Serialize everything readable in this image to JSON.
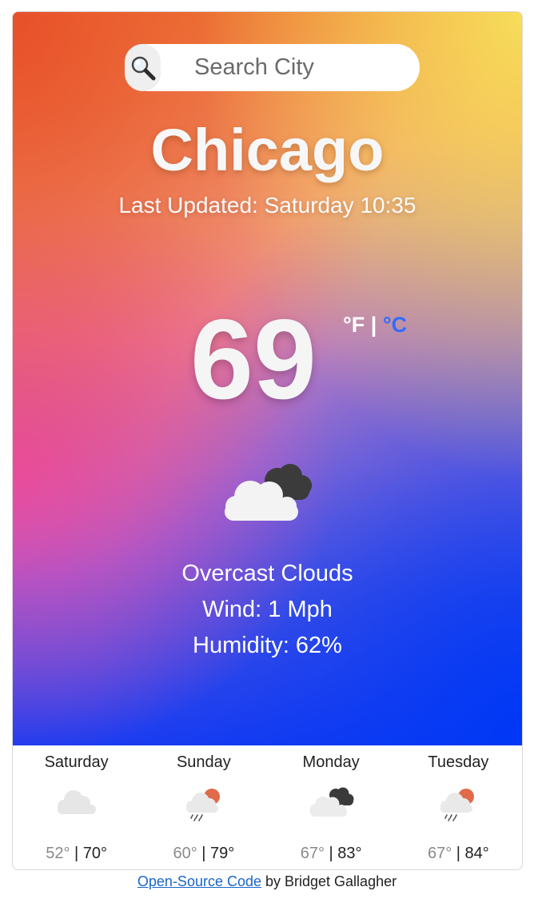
{
  "search": {
    "placeholder": "Search City",
    "icon": "search-icon"
  },
  "current": {
    "city": "Chicago",
    "last_updated": "Last Updated: Saturday 10:35",
    "temperature": "69",
    "unit_f": "°F",
    "unit_sep": " | ",
    "unit_c": "°C",
    "icon": "overcast-clouds-icon",
    "description": "Overcast Clouds",
    "wind": "Wind: 1 Mph",
    "humidity": "Humidity: 62%"
  },
  "forecast": [
    {
      "day": "Saturday",
      "low": "52°",
      "high": "70°",
      "icon": "cloud-icon"
    },
    {
      "day": "Sunday",
      "low": "60°",
      "high": "79°",
      "icon": "rain-sun-icon"
    },
    {
      "day": "Monday",
      "low": "67°",
      "high": "83°",
      "icon": "overcast-clouds-icon"
    },
    {
      "day": "Tuesday",
      "low": "67°",
      "high": "84°",
      "icon": "rain-sun-icon"
    }
  ],
  "footer": {
    "link_text": "Open-Source Code",
    "suffix": " by Bridget Gallagher"
  },
  "colors": {
    "unit_active": "#2f6dff",
    "link": "#1a66c9",
    "gradient_top_left": "#e8502a",
    "gradient_top_right": "#f7dd5a",
    "gradient_mid_left": "#ea4ab4",
    "gradient_bottom": "#0038f5"
  }
}
